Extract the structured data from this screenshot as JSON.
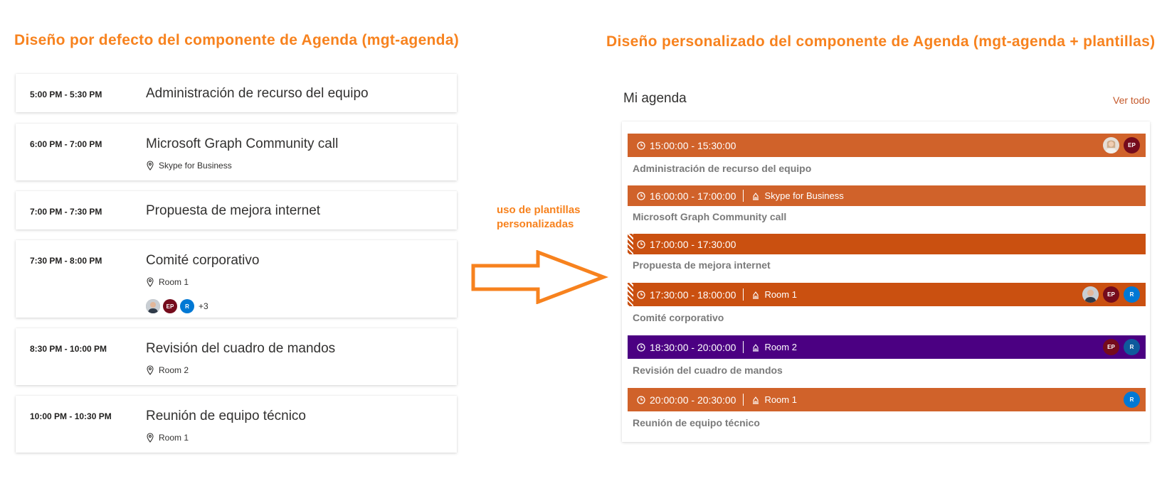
{
  "headings": {
    "left": "Diseño por defecto del componente de Agenda (mgt-agenda)",
    "right": "Diseño personalizado del componente de Agenda (mgt-agenda + plantillas)"
  },
  "default_agenda": [
    {
      "time": "5:00 PM - 5:30 PM",
      "title": "Administración de recurso del equipo"
    },
    {
      "time": "6:00 PM - 7:00 PM",
      "title": "Microsoft Graph Community call",
      "location": "Skype for Business"
    },
    {
      "time": "7:00 PM - 7:30 PM",
      "title": "Propuesta de mejora internet"
    },
    {
      "time": "7:30 PM - 8:00 PM",
      "title": "Comité corporativo",
      "location": "Room 1",
      "attendees": [
        "photo",
        "EP",
        "R"
      ],
      "more": "+3"
    },
    {
      "time": "8:30 PM - 10:00 PM",
      "title": "Revisión del cuadro de mandos",
      "location": "Room 2"
    },
    {
      "time": "10:00 PM - 10:30 PM",
      "title": "Reunión de equipo técnico",
      "location": "Room 1"
    }
  ],
  "middle_label": "uso de plantillas personalizadas",
  "custom_agenda": {
    "title": "Mi agenda",
    "see_all": "Ver todo",
    "events": [
      {
        "time": "15:00:00 - 15:30:00",
        "title": "Administración de recurso del equipo",
        "color": "#d0622a",
        "attendees": [
          "photo",
          "EP"
        ]
      },
      {
        "time": "16:00:00 - 17:00:00",
        "location": "Skype for Business",
        "title": "Microsoft Graph Community call",
        "color": "#d0622a"
      },
      {
        "time": "17:00:00 - 17:30:00",
        "title": "Propuesta de mejora internet",
        "color": "#ca5010",
        "tentative": true
      },
      {
        "time": "17:30:00 - 18:00:00",
        "location": "Room 1",
        "title": "Comité corporativo",
        "color": "#ca5010",
        "tentative": true,
        "attendees": [
          "photo",
          "EP",
          "R"
        ]
      },
      {
        "time": "18:30:00 - 20:00:00",
        "location": "Room 2",
        "title": "Revisión del cuadro de mandos",
        "color": "#4b0082",
        "attendees": [
          "EP",
          "R"
        ]
      },
      {
        "time": "20:00:00 - 20:30:00",
        "location": "Room 1",
        "title": "Reunión de equipo técnico",
        "color": "#d0622a",
        "attendees": [
          "R"
        ]
      }
    ]
  },
  "colors": {
    "accent": "#f7821e",
    "link": "#c4582a",
    "avatar_ep": "#750b1c",
    "avatar_r": "#0078d4"
  },
  "icons": [
    "location-pin-icon",
    "clock-icon",
    "building-icon",
    "right-arrow-icon"
  ]
}
